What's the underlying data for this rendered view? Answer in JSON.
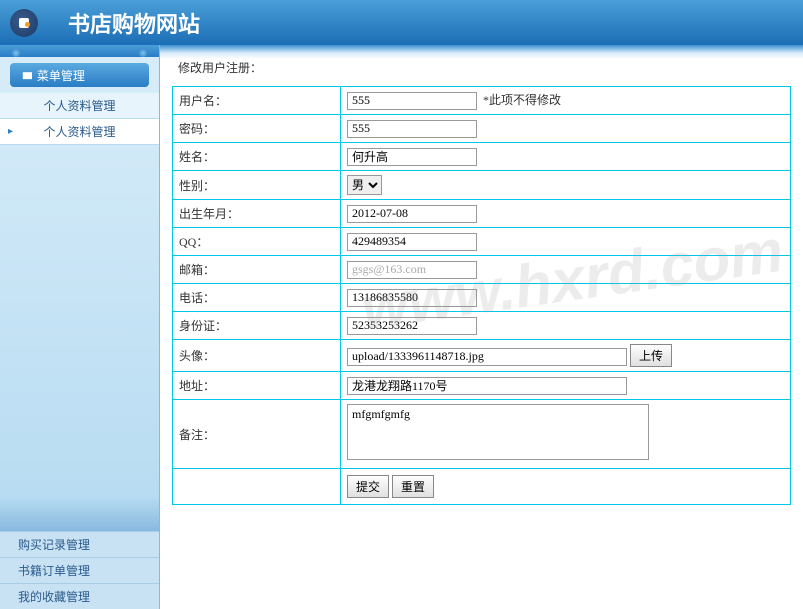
{
  "site": {
    "title": "书店购物网站"
  },
  "sidebar": {
    "header": "菜单管理",
    "items": [
      "个人资料管理",
      "个人资料管理"
    ],
    "bottom": [
      "购买记录管理",
      "书籍订单管理",
      "我的收藏管理"
    ]
  },
  "form": {
    "title": "修改用户注册：",
    "labels": {
      "username": "用户名：",
      "password": "密码：",
      "name": "姓名：",
      "gender": "性别：",
      "birth": "出生年月：",
      "qq": "QQ：",
      "email": "邮箱：",
      "phone": "电话：",
      "id": "身份证：",
      "avatar": "头像：",
      "address": "地址：",
      "remark": "备注："
    },
    "values": {
      "username": "555",
      "password": "555",
      "name": "何升高",
      "gender": "男",
      "birth": "2012-07-08",
      "qq": "429489354",
      "email_ph": "gsgs@163.com",
      "phone": "13186835580",
      "id": "52353253262",
      "avatar": "upload/1333961148718.jpg",
      "address": "龙港龙翔路1170号",
      "remark": "mfgmfgmfg"
    },
    "note": "*此项不得修改",
    "buttons": {
      "upload": "上传",
      "submit": "提交",
      "reset": "重置"
    }
  },
  "watermark": "www.hxrd.com"
}
